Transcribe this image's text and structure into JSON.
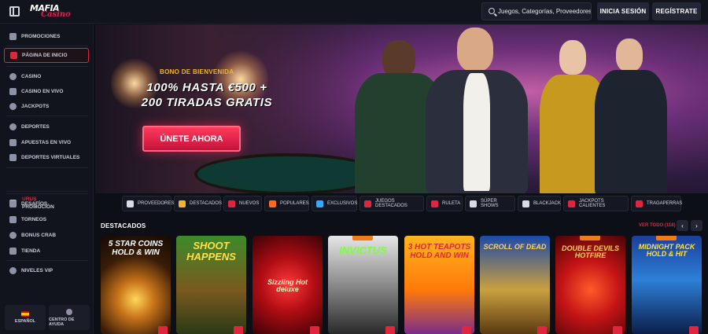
{
  "brand": {
    "logo_line1": "MAFIA",
    "logo_line2": "Casino"
  },
  "header": {
    "search_placeholder": "Juegos, Categorías, Proveedores",
    "login_label": "INICIA SESIÓN",
    "register_label": "REGÍSTRATE"
  },
  "sidebar": {
    "items": [
      {
        "label": "PROMOCIONES",
        "icon": "gift-icon"
      },
      {
        "label": "PÁGINA DE INICIO",
        "icon": "home-icon",
        "active": true
      },
      {
        "label": "CASINO",
        "icon": "casino-chip-icon"
      },
      {
        "label": "CASINO EN VIVO",
        "icon": "live-casino-icon"
      },
      {
        "label": "JACKPOTS",
        "icon": "jackpot-icon"
      },
      {
        "label": "DEPORTES",
        "icon": "soccer-ball-icon"
      },
      {
        "label": "APUESTAS EN VIVO",
        "icon": "live-bets-icon"
      },
      {
        "label": "DEPORTES VIRTUALES",
        "icon": "virtual-sports-icon"
      },
      {
        "label": "DESAFÍOS",
        "icon": "challenge-icon"
      },
      {
        "label": "TORNEOS",
        "icon": "trophy-icon"
      },
      {
        "label": "BONUS CRAB",
        "icon": "crab-icon"
      },
      {
        "label": "TIENDA",
        "icon": "shop-icon"
      },
      {
        "label": "NIVELES VIP",
        "icon": "vip-icon"
      }
    ],
    "urus": {
      "title": "URUS",
      "subtitle": "PROMOCIÓN"
    },
    "language_label": "ESPAÑOL",
    "help_label": "CENTRO DE AYUDA"
  },
  "banner": {
    "eyebrow": "BONO DE BIENVENIDA",
    "title_line1": "100% HASTA €500 +",
    "title_line2": "200 TIRADAS GRATIS",
    "cta_label": "ÚNETE AHORA"
  },
  "categories": [
    {
      "label": "PROVEEDORES",
      "icon": "providers-icon",
      "color": "#d9dce6"
    },
    {
      "label": "DESTACADOS",
      "icon": "crown-icon",
      "color": "#f0b52c"
    },
    {
      "label": "NUEVOS",
      "icon": "new-icon",
      "color": "#e0263f"
    },
    {
      "label": "POPULARES",
      "icon": "flame-icon",
      "color": "#ff6a1f"
    },
    {
      "label": "EXCLUSIVOS",
      "icon": "diamond-icon",
      "color": "#3aa7ff"
    },
    {
      "label": "JUEGOS DESTACADOS",
      "icon": "featured-icon",
      "color": "#e0263f"
    },
    {
      "label": "RULETA",
      "icon": "roulette-icon",
      "color": "#e0263f"
    },
    {
      "label": "SÚPER SHOWS",
      "icon": "microphone-icon",
      "color": "#d9dce6"
    },
    {
      "label": "BLACKJACK",
      "icon": "cards-icon",
      "color": "#d9dce6"
    },
    {
      "label": "JACKPOTS CALIENTES",
      "icon": "hot-jackpot-icon",
      "color": "#e0263f"
    },
    {
      "label": "TRAGAPERRAS",
      "icon": "slot-icon",
      "color": "#e0263f"
    }
  ],
  "featured": {
    "title": "DESTACADOS",
    "see_all": "VER TODO (118)",
    "prev_label": "‹",
    "next_label": "›",
    "games": [
      {
        "name": "5 STAR COINS HOLD & WIN",
        "new": false
      },
      {
        "name": "SHOOT HAPPENS",
        "new": false
      },
      {
        "name": "Sizzling Hot deluxe",
        "new": false
      },
      {
        "name": "INVICTUS",
        "new": true
      },
      {
        "name": "3 HOT TEAPOTS HOLD AND WIN",
        "new": false
      },
      {
        "name": "SCROLL OF DEAD",
        "new": false
      },
      {
        "name": "DOUBLE DEVILS HOTFIRE",
        "new": true
      },
      {
        "name": "MIDNIGHT PACK HOLD & HIT",
        "new": true
      }
    ],
    "new_tag": "NUEVO"
  },
  "colors": {
    "accent": "#e0263f",
    "gold": "#f0b52c",
    "bg": "#0d0f17",
    "panel": "#12141d"
  }
}
